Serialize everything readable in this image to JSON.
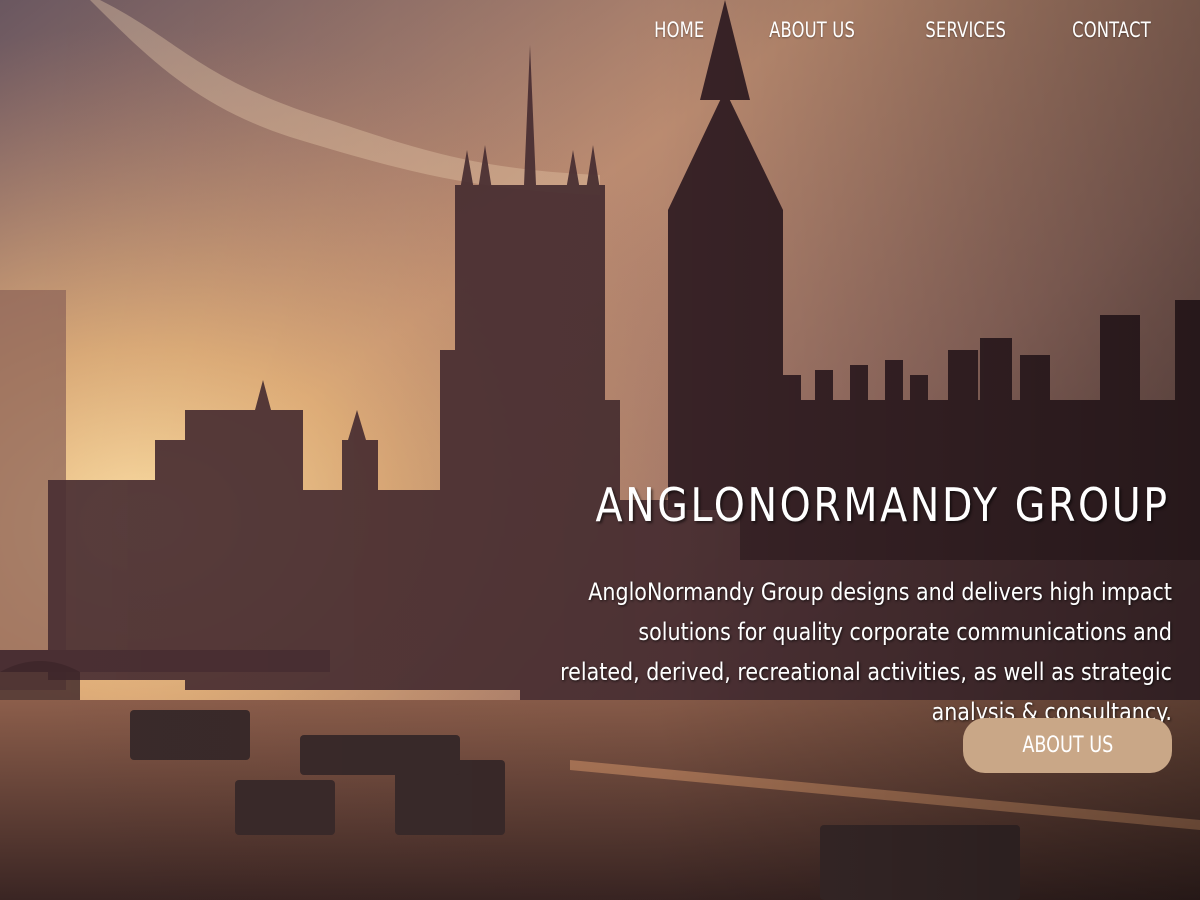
{
  "nav": {
    "items": [
      {
        "label": "HOME"
      },
      {
        "label": "ABOUT US"
      },
      {
        "label": "SERVICES"
      },
      {
        "label": "CONTACT"
      }
    ]
  },
  "hero": {
    "title": "ANGLONORMANDY GROUP",
    "description": "AngloNormandy Group designs and delivers high impact solutions for quality corporate communications and related, derived, recreational activities, as well as strategic analysis & consultancy.",
    "cta_label": "ABOUT US",
    "background_image": "sunset-london-skyline-photo"
  },
  "colors": {
    "cta_background": "#c9a787",
    "text": "#ffffff",
    "sky_light": "#e9b978",
    "sky_dark": "#5f4a52",
    "silhouette": "#3c2529"
  }
}
